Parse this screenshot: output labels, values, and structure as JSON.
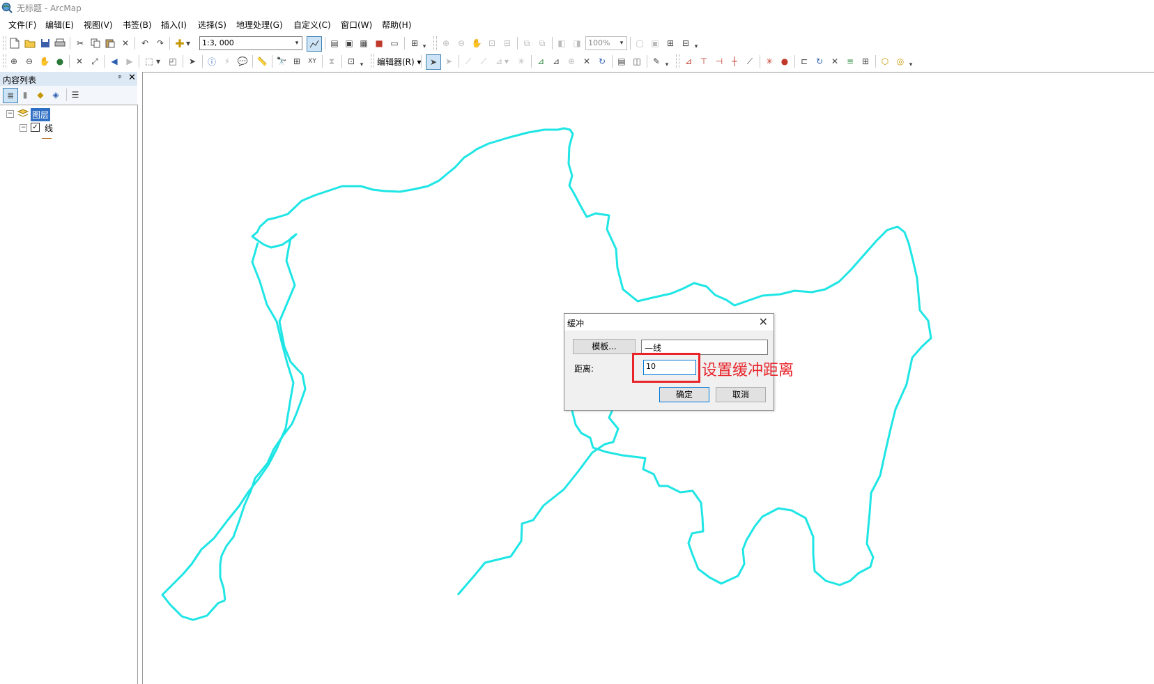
{
  "window": {
    "title": "无标题 - ArcMap"
  },
  "menu": [
    "文件(F)",
    "编辑(E)",
    "视图(V)",
    "书签(B)",
    "插入(I)",
    "选择(S)",
    "地理处理(G)",
    "自定义(C)",
    "窗口(W)",
    "帮助(H)"
  ],
  "toolbar": {
    "scale": "1:3, 000",
    "zoom_percent": "100%",
    "editor_label": "编辑器(R) ▾"
  },
  "toc": {
    "title": "内容列表",
    "pin_glyph": "ᵖ",
    "close_glyph": "✕",
    "group_label": "图层",
    "layer_label": "线",
    "layer_checked": true
  },
  "dialog": {
    "title": "缓冲",
    "template_button": "模板...",
    "template_value": "—线",
    "distance_label": "距离:",
    "distance_value": "10",
    "ok": "确定",
    "cancel": "取消"
  },
  "annotation": {
    "text": "设置缓冲距离",
    "color": "#e8242a"
  },
  "map": {
    "line_color": "#1fe5e5"
  }
}
